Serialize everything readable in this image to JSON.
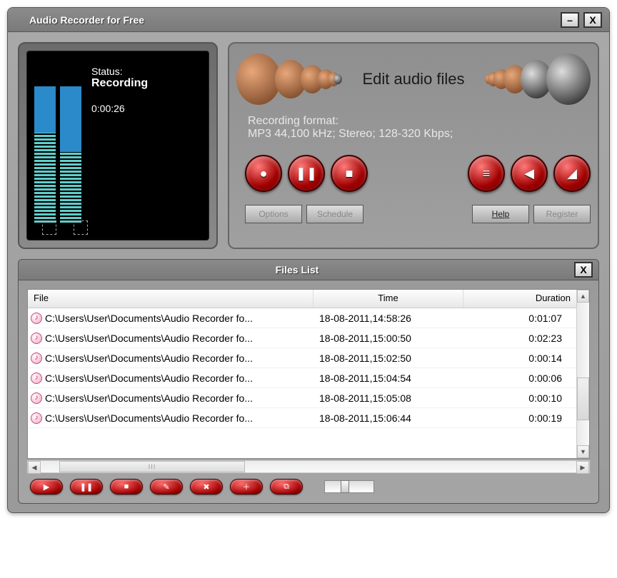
{
  "titlebar": {
    "title": "Audio Recorder for Free"
  },
  "meter": {
    "status_label": "Status:",
    "status_value": "Recording",
    "elapsed": "0:00:26",
    "bar1_top_pct": 28,
    "bar1_bot_pct": 55,
    "bar2_top_pct": 40,
    "bar2_bot_pct": 43
  },
  "right": {
    "edit_label": "Edit audio files",
    "format_label": "Recording format:",
    "format_value": "MP3 44,100 kHz; Stereo;  128-320 Kbps;",
    "buttons": {
      "record": "record",
      "pause": "pause",
      "stop": "stop",
      "list": "list",
      "prev": "prev",
      "skip": "skip",
      "options": "Options",
      "schedule": "Schedule",
      "help": "Help",
      "register": "Register"
    }
  },
  "files": {
    "title": "Files List",
    "columns": {
      "file": "File",
      "time": "Time",
      "duration": "Duration"
    },
    "rows": [
      {
        "file": "C:\\Users\\User\\Documents\\Audio Recorder fo...",
        "time": "18-08-2011,14:58:26",
        "duration": "0:01:07"
      },
      {
        "file": "C:\\Users\\User\\Documents\\Audio Recorder fo...",
        "time": "18-08-2011,15:00:50",
        "duration": "0:02:23"
      },
      {
        "file": "C:\\Users\\User\\Documents\\Audio Recorder fo...",
        "time": "18-08-2011,15:02:50",
        "duration": "0:00:14"
      },
      {
        "file": "C:\\Users\\User\\Documents\\Audio Recorder fo...",
        "time": "18-08-2011,15:04:54",
        "duration": "0:00:06"
      },
      {
        "file": "C:\\Users\\User\\Documents\\Audio Recorder fo...",
        "time": "18-08-2011,15:05:08",
        "duration": "0:00:10"
      },
      {
        "file": "C:\\Users\\User\\Documents\\Audio Recorder fo...",
        "time": "18-08-2011,15:06:44",
        "duration": "0:00:19"
      }
    ]
  },
  "toolbar": {
    "items": [
      "play",
      "pause",
      "stop",
      "edit",
      "delete",
      "add",
      "copy"
    ]
  }
}
